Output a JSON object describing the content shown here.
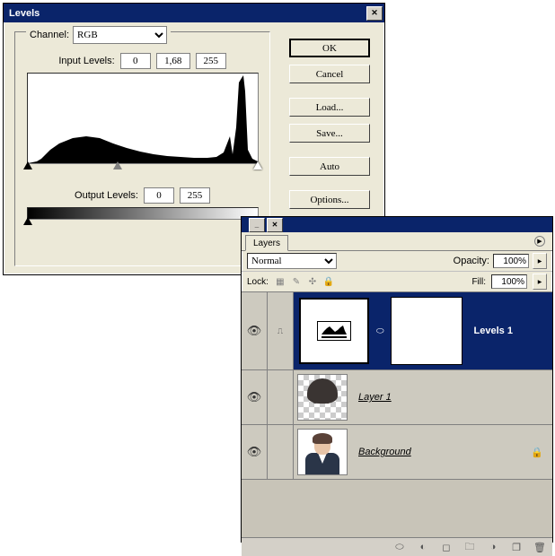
{
  "levels": {
    "title": "Levels",
    "channel_label": "Channel:",
    "channel_value": "RGB",
    "input_label": "Input Levels:",
    "input_black": "0",
    "input_gamma": "1,68",
    "input_white": "255",
    "output_label": "Output Levels:",
    "output_black": "0",
    "output_white": "255",
    "buttons": {
      "ok": "OK",
      "cancel": "Cancel",
      "load": "Load...",
      "save": "Save...",
      "auto": "Auto",
      "options": "Options..."
    }
  },
  "layers": {
    "tab": "Layers",
    "blend_mode": "Normal",
    "opacity_label": "Opacity:",
    "opacity_value": "100%",
    "lock_label": "Lock:",
    "fill_label": "Fill:",
    "fill_value": "100%",
    "items": [
      {
        "name": "Levels 1",
        "type": "adjustment",
        "selected": true
      },
      {
        "name": "Layer 1",
        "type": "image",
        "selected": false
      },
      {
        "name": "Background",
        "type": "background",
        "locked": true,
        "selected": false
      }
    ]
  }
}
